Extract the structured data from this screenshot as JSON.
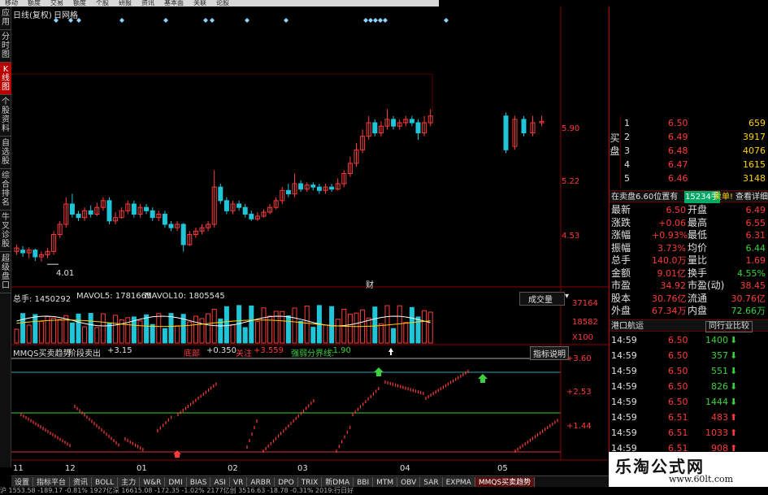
{
  "topbar": {
    "items": [
      "移动",
      "额度",
      "交易",
      "额度",
      "个股",
      "研报",
      "资讯",
      "基本面",
      "关联",
      "论股"
    ]
  },
  "left_tabs": [
    {
      "label": "应用",
      "active": false
    },
    {
      "label": "分时图",
      "active": false
    },
    {
      "label": "K线图",
      "active": true
    },
    {
      "label": "个股资料",
      "active": false
    },
    {
      "label": "自选股",
      "active": false
    },
    {
      "label": "综合排名",
      "active": false
    },
    {
      "label": "牛叉诊股",
      "active": false
    },
    {
      "label": "超级盘口",
      "active": false
    }
  ],
  "chart_header": {
    "period": "日线(复权)",
    "tag": "日网格"
  },
  "price_axis": [
    "5.90",
    "5.22",
    "4.53"
  ],
  "low_label": "4.01",
  "finance_marker": "财",
  "volume_header": {
    "total": "总手: 1450292",
    "mavol5": "MAVOL5: 1781665",
    "mavol10": "MAVOL10: 1805545",
    "selector": "成交量"
  },
  "volume_axis": [
    "37164",
    "18582",
    "X100"
  ],
  "indicator_header": {
    "name": "MMQS买卖趋势",
    "t1": "阶段卖出",
    "v1": "+3.15",
    "t2": "底部",
    "v2": "+0.350",
    "t3": "关注",
    "v3": "+3.559",
    "t4": "强弱分界线:",
    "v4": "-1.90",
    "btn": "指标说明"
  },
  "indicator_axis": [
    "+3.60",
    "+2.53",
    "+1.44"
  ],
  "date_axis": [
    "11",
    "12",
    "01",
    "02",
    "03",
    "04",
    "05"
  ],
  "bottom_tabs": [
    {
      "label": "设置",
      "active": false
    },
    {
      "label": "指标平台",
      "active": false
    },
    {
      "label": "资讯",
      "active": false
    },
    {
      "label": "BOLL",
      "active": false
    },
    {
      "label": "主力",
      "active": false
    },
    {
      "label": "W&R",
      "active": false
    },
    {
      "label": "DMI",
      "active": false
    },
    {
      "label": "BIAS",
      "active": false
    },
    {
      "label": "ASI",
      "active": false
    },
    {
      "label": "VR",
      "active": false
    },
    {
      "label": "ARBR",
      "active": false
    },
    {
      "label": "DPO",
      "active": false
    },
    {
      "label": "TRIX",
      "active": false
    },
    {
      "label": "新DMA",
      "active": false
    },
    {
      "label": "BBI",
      "active": false
    },
    {
      "label": "MTM",
      "active": false
    },
    {
      "label": "OBV",
      "active": false
    },
    {
      "label": "SAR",
      "active": false
    },
    {
      "label": "EXPMA",
      "active": false
    },
    {
      "label": "MMQS买卖趋势",
      "active": true
    }
  ],
  "order_book": {
    "side_label": "买盘",
    "rows": [
      {
        "level": "1",
        "price": "6.50",
        "vol": "659"
      },
      {
        "level": "2",
        "price": "6.49",
        "vol": "3917"
      },
      {
        "level": "3",
        "price": "6.48",
        "vol": "4076"
      },
      {
        "level": "4",
        "price": "6.47",
        "vol": "1615"
      },
      {
        "level": "5",
        "price": "6.46",
        "vol": "3148"
      }
    ]
  },
  "sell_notice": {
    "text1": "在卖盘6.60位置有",
    "vol": "15234手",
    "text2": "卖单!",
    "link": "查看详细"
  },
  "quote": [
    {
      "k1": "最新",
      "v1": "6.50",
      "k2": "开盘",
      "v2": "6.49"
    },
    {
      "k1": "涨跌",
      "v1": "+0.06",
      "k2": "最高",
      "v2": "6.55"
    },
    {
      "k1": "涨幅",
      "v1": "+0.93%",
      "k2": "最低",
      "v2": "6.31"
    },
    {
      "k1": "振幅",
      "v1": "3.73%",
      "k2": "均价",
      "v2": "6.44"
    },
    {
      "k1": "总手",
      "v1": "140.0万",
      "k2": "量比",
      "v2": "1.69"
    },
    {
      "k1": "金额",
      "v1": "9.01亿",
      "k2": "换手",
      "v2": "4.55%"
    },
    {
      "k1": "市盈",
      "v1": "34.92",
      "k2": "市盈(动)",
      "v2": "38.45"
    },
    {
      "k1": "股本",
      "v1": "30.76亿",
      "k2": "流通",
      "v2": "30.76亿"
    },
    {
      "k1": "外盘",
      "v1": "67.34万",
      "k2": "内盘",
      "v2": "72.66万"
    }
  ],
  "sector_bar": {
    "left": "港口航运",
    "right": "同行业比较"
  },
  "ticks": [
    {
      "time": "14:59",
      "price": "6.50",
      "vol": "1400",
      "dir": "down"
    },
    {
      "time": "14:59",
      "price": "6.50",
      "vol": "357",
      "dir": "down"
    },
    {
      "time": "14:59",
      "price": "6.50",
      "vol": "551",
      "dir": "down"
    },
    {
      "time": "14:59",
      "price": "6.50",
      "vol": "826",
      "dir": "down"
    },
    {
      "time": "14:59",
      "price": "6.50",
      "vol": "1444",
      "dir": "down"
    },
    {
      "time": "14:59",
      "price": "6.51",
      "vol": "483",
      "dir": "up"
    },
    {
      "time": "14:59",
      "price": "6.51",
      "vol": "1033",
      "dir": "up"
    },
    {
      "time": "14:59",
      "price": "6.51",
      "vol": "908",
      "dir": "up"
    }
  ],
  "watermark": {
    "line1": "乐淘公式网",
    "line2": "www.60lt.com"
  },
  "status": {
    "text": "沪 1553.58  -189.17  -0.81%  1927亿深  16615.08  -172.35  -1.02%  2177亿创  3516.63  -18.78  -0.31%  2019:行日好"
  },
  "colors": {
    "up": "#ff3b3b",
    "down": "#21c5d8",
    "green": "#3cd23c",
    "yellow": "#ffd200"
  },
  "chart_data": {
    "type": "candlestick",
    "price_labels": [
      "5.90",
      "5.22",
      "4.53"
    ],
    "low_point": 4.01,
    "candles": [
      [
        4.2,
        4.25,
        4.15,
        4.3
      ],
      [
        4.22,
        4.18,
        4.12,
        4.28
      ],
      [
        4.18,
        4.22,
        4.1,
        4.26
      ],
      [
        4.22,
        4.12,
        4.06,
        4.24
      ],
      [
        4.12,
        4.15,
        4.05,
        4.2
      ],
      [
        4.15,
        4.2,
        4.1,
        4.25
      ],
      [
        4.2,
        4.45,
        4.15,
        4.5
      ],
      [
        4.45,
        4.6,
        4.4,
        4.65
      ],
      [
        4.6,
        4.9,
        4.55,
        5.0
      ],
      [
        4.9,
        4.75,
        4.7,
        5.05
      ],
      [
        4.75,
        4.7,
        4.65,
        4.8
      ],
      [
        4.7,
        4.8,
        4.65,
        4.85
      ],
      [
        4.8,
        4.75,
        4.7,
        4.88
      ],
      [
        4.75,
        4.85,
        4.72,
        4.92
      ],
      [
        4.85,
        4.95,
        4.8,
        5.0
      ],
      [
        4.95,
        4.65,
        4.6,
        5.0
      ],
      [
        4.65,
        4.7,
        4.6,
        4.78
      ],
      [
        4.7,
        4.8,
        4.68,
        4.85
      ],
      [
        4.8,
        4.9,
        4.75,
        4.95
      ],
      [
        4.9,
        4.75,
        4.7,
        4.95
      ],
      [
        4.75,
        4.85,
        4.7,
        4.9
      ],
      [
        4.85,
        4.8,
        4.75,
        4.9
      ],
      [
        4.8,
        4.7,
        4.65,
        4.85
      ],
      [
        4.7,
        4.75,
        4.65,
        4.8
      ],
      [
        4.75,
        4.6,
        4.55,
        4.8
      ],
      [
        4.6,
        4.55,
        4.5,
        4.65
      ],
      [
        4.55,
        4.6,
        4.5,
        4.65
      ],
      [
        4.6,
        4.3,
        4.2,
        4.62
      ],
      [
        4.3,
        4.45,
        4.28,
        4.5
      ],
      [
        4.45,
        4.5,
        4.4,
        4.55
      ],
      [
        4.5,
        4.55,
        4.45,
        4.6
      ],
      [
        4.55,
        4.6,
        4.5,
        4.65
      ],
      [
        4.6,
        5.15,
        4.55,
        5.4
      ],
      [
        5.15,
        4.95,
        4.9,
        5.2
      ],
      [
        4.95,
        4.8,
        4.75,
        5.0
      ],
      [
        4.8,
        4.9,
        4.75,
        4.95
      ],
      [
        4.9,
        4.85,
        4.8,
        4.95
      ],
      [
        4.85,
        4.75,
        4.7,
        4.9
      ],
      [
        4.75,
        4.68,
        4.65,
        4.8
      ],
      [
        4.68,
        4.72,
        4.65,
        4.78
      ],
      [
        4.72,
        4.78,
        4.7,
        4.82
      ],
      [
        4.78,
        4.85,
        4.75,
        4.9
      ],
      [
        4.85,
        4.95,
        4.82,
        5.0
      ],
      [
        4.95,
        5.1,
        4.9,
        5.15
      ],
      [
        5.1,
        5.05,
        5.0,
        5.2
      ],
      [
        5.05,
        5.2,
        5.0,
        5.35
      ],
      [
        5.2,
        5.12,
        5.08,
        5.25
      ],
      [
        5.12,
        5.18,
        5.08,
        5.22
      ],
      [
        5.18,
        5.15,
        5.1,
        5.22
      ],
      [
        5.15,
        5.1,
        5.05,
        5.2
      ],
      [
        5.1,
        5.15,
        5.05,
        5.2
      ],
      [
        5.15,
        5.12,
        5.08,
        5.2
      ],
      [
        5.12,
        5.2,
        5.1,
        5.28
      ],
      [
        5.2,
        5.35,
        5.15,
        5.4
      ],
      [
        5.35,
        5.5,
        5.3,
        5.6
      ],
      [
        5.5,
        5.7,
        5.45,
        5.8
      ],
      [
        5.7,
        5.9,
        5.65,
        6.0
      ],
      [
        5.9,
        6.1,
        5.85,
        6.2
      ],
      [
        6.1,
        5.95,
        5.9,
        6.15
      ],
      [
        5.95,
        6.05,
        5.9,
        6.12
      ],
      [
        6.05,
        6.15,
        6.0,
        6.3
      ],
      [
        6.15,
        6.05,
        6.0,
        6.2
      ],
      [
        6.05,
        6.1,
        6.0,
        6.15
      ],
      [
        6.1,
        6.15,
        6.05,
        6.2
      ],
      [
        6.15,
        6.1,
        6.05,
        6.2
      ],
      [
        6.1,
        5.95,
        5.85,
        6.15
      ],
      [
        5.95,
        6.1,
        5.9,
        6.2
      ],
      [
        6.1,
        6.2,
        6.05,
        6.3
      ]
    ],
    "gap_candles": [
      [
        6.2,
        5.7,
        5.65,
        6.25
      ],
      [
        5.75,
        6.15,
        5.7,
        6.2
      ],
      [
        6.15,
        5.95,
        5.9,
        6.2
      ],
      [
        5.95,
        6.1,
        5.9,
        6.2
      ],
      [
        6.1,
        6.12,
        6.05,
        6.2
      ]
    ]
  }
}
